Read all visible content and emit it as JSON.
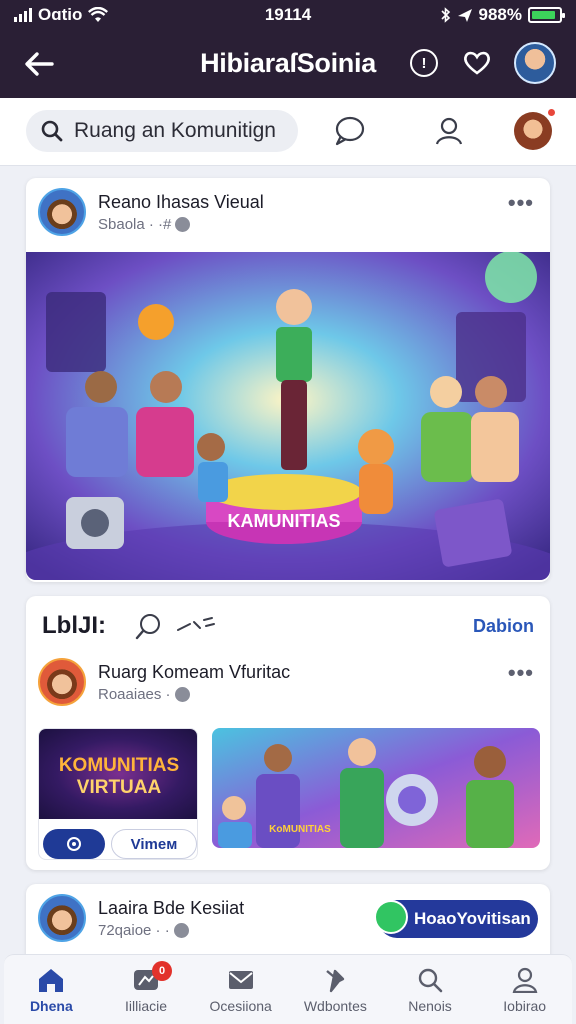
{
  "status_bar": {
    "carrier": "Oɑtio",
    "time": "19114",
    "battery": "988%",
    "battery_level": 0.88
  },
  "app_bar": {
    "title": "HibiaraſSoinia"
  },
  "search": {
    "value": "Ruang an Komunitign"
  },
  "post1": {
    "username": "Reano Ihasas Vieual",
    "meta": "Sbaola · ·#",
    "image_caption": "KAMUNITIAS"
  },
  "section": {
    "title": "LblJI:",
    "link": "Dabion",
    "post": {
      "username": "Ruarg Komeam Vfuritac",
      "meta": "Roaaiaes ·"
    },
    "tile": {
      "line1": "KOMUNITIAS",
      "line2": "VIRTUAA",
      "button_secondary": "Vimeм"
    },
    "image_caption": "KoMUNITIAS"
  },
  "post3": {
    "username": "Laaira Bde Kesiiat",
    "meta": "72qaioe · ·",
    "pill_label": "HoaoYovitisan"
  },
  "bottom_nav": [
    {
      "label": "Dhena",
      "icon": "home-icon",
      "active": true
    },
    {
      "label": "Iilliacie",
      "icon": "notifications-icon",
      "badge": "0"
    },
    {
      "label": "Ocesiiona",
      "icon": "mail-icon"
    },
    {
      "label": "Wdbontes",
      "icon": "pin-icon"
    },
    {
      "label": "Nenois",
      "icon": "search-icon"
    },
    {
      "label": "Iobirao",
      "icon": "profile-icon"
    }
  ],
  "colors": {
    "app_bar_bg": "#2a1f35",
    "accent": "#24399b",
    "battery_green": "#3cd35b",
    "badge_red": "#e2322b"
  }
}
